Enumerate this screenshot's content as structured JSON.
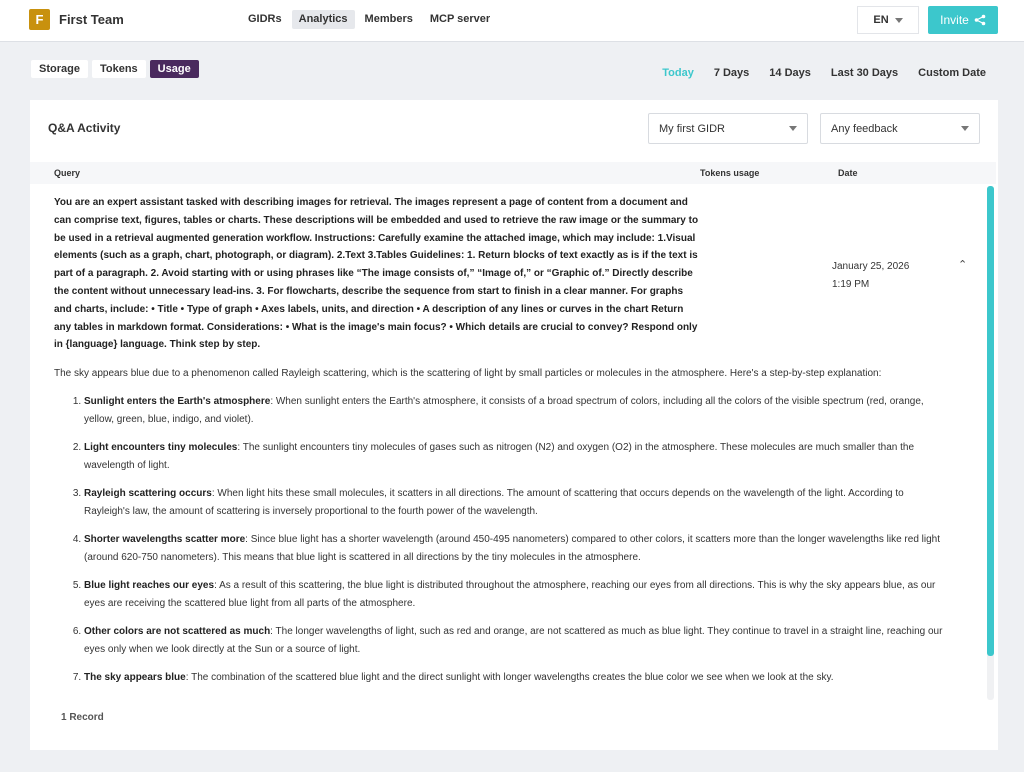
{
  "header": {
    "logo_letter": "F",
    "team_name": "First Team",
    "nav": [
      "GIDRs",
      "Analytics",
      "Members",
      "MCP server"
    ],
    "active_nav": "Analytics",
    "language": "EN",
    "invite_label": "Invite"
  },
  "subtabs": {
    "items": [
      "Storage",
      "Tokens",
      "Usage"
    ],
    "active": "Usage"
  },
  "ranges": {
    "items": [
      "Today",
      "7 Days",
      "14 Days",
      "Last 30 Days",
      "Custom Date"
    ],
    "active": "Today"
  },
  "card": {
    "title": "Q&A Activity",
    "gidr_select": "My first GIDR",
    "feedback_select": "Any feedback",
    "columns": [
      "Query",
      "Tokens usage",
      "Date"
    ],
    "row": {
      "query": "You are an expert assistant tasked with describing images for retrieval. The images represent a page of content from a document and can comprise text, figures, tables or charts. These descriptions will be embedded and used to retrieve the raw image or the summary to be used in a retrieval augmented generation workflow. Instructions: Carefully examine the attached image, which may include: 1.Visual elements (such as a graph, chart, photograph, or diagram). 2.Text 3.Tables Guidelines: 1. Return blocks of text exactly as is if the text is part of a paragraph. 2. Avoid starting with or using phrases like “The image consists of,” “Image of,” or “Graphic of.” Directly describe the content without unnecessary lead-ins. 3. For flowcharts, describe the sequence from start to finish in a clear manner. For graphs and charts, include: • Title • Type of graph • Axes labels, units, and direction • A description of any lines or curves in the chart Return any tables in markdown format. Considerations: • What is the image's main focus? • Which details are crucial to convey? Respond only in {language} language. Think step by step.",
      "date": "January 25, 2026",
      "time": "1:19 PM",
      "answer_intro": "The sky appears blue due to a phenomenon called Rayleigh scattering, which is the scattering of light by small particles or molecules in the atmosphere. Here's a step-by-step explanation:",
      "steps": [
        {
          "title": "Sunlight enters the Earth's atmosphere",
          "text": ": When sunlight enters the Earth's atmosphere, it consists of a broad spectrum of colors, including all the colors of the visible spectrum (red, orange, yellow, green, blue, indigo, and violet)."
        },
        {
          "title": "Light encounters tiny molecules",
          "text": ": The sunlight encounters tiny molecules of gases such as nitrogen (N2) and oxygen (O2) in the atmosphere. These molecules are much smaller than the wavelength of light."
        },
        {
          "title": "Rayleigh scattering occurs",
          "text": ": When light hits these small molecules, it scatters in all directions. The amount of scattering that occurs depends on the wavelength of the light. According to Rayleigh's law, the amount of scattering is inversely proportional to the fourth power of the wavelength."
        },
        {
          "title": "Shorter wavelengths scatter more",
          "text": ": Since blue light has a shorter wavelength (around 450-495 nanometers) compared to other colors, it scatters more than the longer wavelengths like red light (around 620-750 nanometers). This means that blue light is scattered in all directions by the tiny molecules in the atmosphere."
        },
        {
          "title": "Blue light reaches our eyes",
          "text": ": As a result of this scattering, the blue light is distributed throughout the atmosphere, reaching our eyes from all directions. This is why the sky appears blue, as our eyes are receiving the scattered blue light from all parts of the atmosphere."
        },
        {
          "title": "Other colors are not scattered as much",
          "text": ": The longer wavelengths of light, such as red and orange, are not scattered as much as blue light. They continue to travel in a straight line, reaching our eyes only when we look directly at the Sun or a source of light."
        },
        {
          "title": "The sky appears blue",
          "text": ": The combination of the scattered blue light and the direct sunlight with longer wavelengths creates the blue color we see when we look at the sky."
        }
      ]
    },
    "records": "1 Record"
  },
  "colors": {
    "accent": "#3cc7cc",
    "active_tab": "#4a2a5e",
    "logo": "#c8910e"
  }
}
